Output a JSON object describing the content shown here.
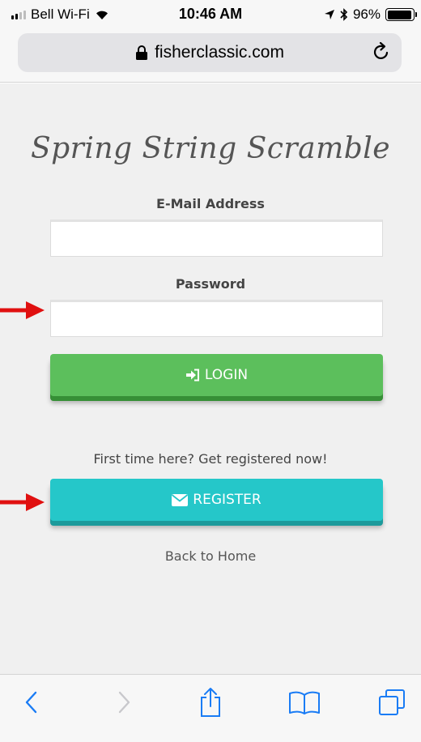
{
  "status_bar": {
    "carrier": "Bell Wi-Fi",
    "time": "10:46 AM",
    "battery": "96%",
    "battery_level": 0.96
  },
  "browser": {
    "url": "fisherclassic.com",
    "icons": {
      "lock": "lock-icon",
      "reload": "reload-icon",
      "back": "chevron-left-icon",
      "forward": "chevron-right-icon",
      "share": "share-icon",
      "bookmarks": "book-icon",
      "tabs": "tabs-icon"
    }
  },
  "page": {
    "title": "Spring String Scramble",
    "email_label": "E-Mail Address",
    "email_value": "",
    "password_label": "Password",
    "password_value": "",
    "login_label": "LOGIN",
    "register_prompt": "First time here? Get registered now!",
    "register_label": "REGISTER",
    "back_link": "Back to Home"
  },
  "colors": {
    "login_button": "#5cbf5c",
    "register_button": "#25c7c9",
    "annotation_arrow": "#e01010",
    "ios_tint": "#1a7cf5"
  }
}
